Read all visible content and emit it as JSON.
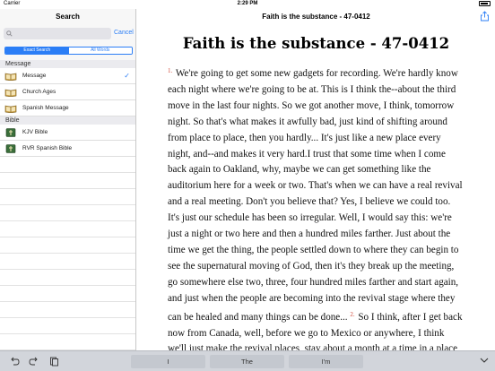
{
  "status_bar": {
    "carrier": "Carrier",
    "time": "2:29 PM"
  },
  "sidebar": {
    "title": "Search",
    "search": {
      "placeholder": "",
      "value": ""
    },
    "cancel_label": "Cancel",
    "segments": [
      "Exact Search",
      "All Words"
    ],
    "selected_segment": "Exact Search",
    "sections": [
      {
        "header": "Message",
        "items": [
          {
            "label": "Message",
            "icon": "book-open-icon",
            "checked": true
          },
          {
            "label": "Church Ages",
            "icon": "book-open-icon",
            "checked": false
          },
          {
            "label": "Spanish Message",
            "icon": "book-open-icon",
            "checked": false
          }
        ]
      },
      {
        "header": "Bible",
        "items": [
          {
            "label": "KJV Bible",
            "icon": "bible-icon",
            "checked": false
          },
          {
            "label": "RVR Spanish Bible",
            "icon": "bible-icon",
            "checked": false
          }
        ]
      }
    ]
  },
  "header": {
    "title": "Faith is the substance - 47-0412",
    "share_icon": "share-icon"
  },
  "document": {
    "title": "Faith is the substance - 47-0412",
    "paragraphs": [
      {
        "num": "1.",
        "text": "We're going to get some new gadgets for recording. We're hardly know each night where we're going to be at. This is I think the--about the third move in the last four nights. So we got another move, I think, tomorrow night. So that's what makes it awfully bad, just kind of shifting around from place to place, then you hardly... It's just like a new place every night, and--and makes it very hard.I trust that some time when I come back again to Oakland, why, maybe we can get something like the auditorium here for a week or two. That's when we can have a real revival and a real meeting. Don't you believe that? Yes, I believe we could too."
      },
      {
        "num": "",
        "text": "It's just our schedule has been so irregular. Well, I would say this: we're just a night or two here and then a hundred miles farther. Just about the time we get the thing, the people settled down to where they can begin to see the supernatural moving of God, then it's they break up the meeting, go somewhere else two, three, four hundred miles farther and start again, and just when the people are becoming into the revival stage where they can be healed and many things can be done..."
      },
      {
        "num": "2.",
        "text": "So I think, after I get back now from Canada, well, before we go to Mexico or anywhere, I think we'll just make the revival places, stay about a month at a time in a place, or"
      }
    ]
  },
  "toolbar": {
    "suggestions": [
      "I",
      "The",
      "I'm"
    ],
    "icons": [
      "undo-icon",
      "redo-icon",
      "paste-icon",
      "chevron-down-icon"
    ]
  },
  "colors": {
    "accent": "#2b7ef6",
    "paragraph_number": "#d14a3a",
    "toolbar": "#d2d5db"
  }
}
